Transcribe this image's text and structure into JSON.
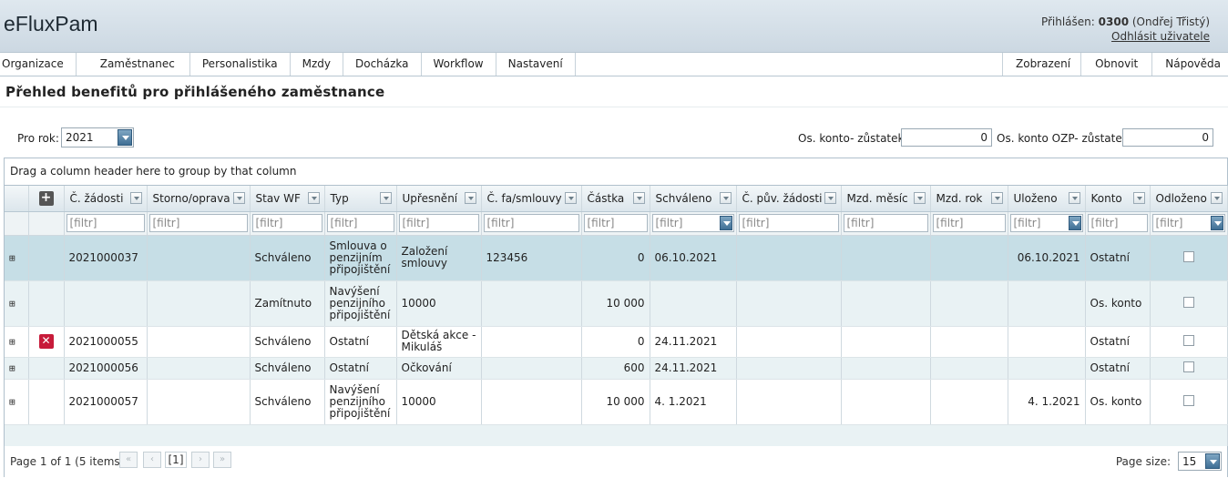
{
  "app": {
    "title": "eFluxPam"
  },
  "user": {
    "logged_label": "Přihlášen:",
    "id": "0300",
    "name": "(Ondřej Třistý)",
    "logout": "Odhlásit uživatele"
  },
  "menu": {
    "left": [
      "Organizace",
      "Zaměstnanec",
      "Personalistika",
      "Mzdy",
      "Docházka",
      "Workflow",
      "Nastavení"
    ],
    "right": [
      "Zobrazení",
      "Obnovit",
      "Nápověda"
    ]
  },
  "page": {
    "title": "Přehled benefitů pro přihlášeného zaměstnance"
  },
  "filters": {
    "year_label": "Pro rok:",
    "year_value": "2021",
    "konto_label": "Os. konto- zůstatek:",
    "konto_value": "0",
    "ozp_label": "Os. konto OZP- zůstatek:",
    "ozp_value": "0"
  },
  "grid": {
    "group_panel": "Drag a column header here to group by that column",
    "filter_placeholder": "[filtr]",
    "columns": [
      "Č. žádosti",
      "Storno/oprava",
      "Stav WF",
      "Typ",
      "Upřesnění",
      "Č. fa/smlouvy",
      "Částka",
      "Schváleno",
      "Č. pův. žádosti",
      "Mzd. měsíc",
      "Mzd. rok",
      "Uloženo",
      "Konto",
      "Odloženo"
    ],
    "rows": [
      {
        "cislo": "2021000037",
        "storno": "",
        "stav": "Schváleno",
        "typ": "Smlouva o penzijním připojištění",
        "upresneni": "Založení smlouvy",
        "fa": "123456",
        "castka": "0",
        "schvaleno": "06.10.2021",
        "puv": "",
        "mesic": "",
        "rok": "",
        "ulozeno": "06.10.2021",
        "konto": "Ostatní",
        "delete": false
      },
      {
        "cislo": "",
        "storno": "",
        "stav": "Zamítnuto",
        "typ": "Navýšení penzijního připojištění",
        "upresneni": "10000",
        "fa": "",
        "castka": "10 000",
        "schvaleno": "",
        "puv": "",
        "mesic": "",
        "rok": "",
        "ulozeno": "",
        "konto": "Os. konto",
        "delete": false
      },
      {
        "cislo": "2021000055",
        "storno": "",
        "stav": "Schváleno",
        "typ": "Ostatní",
        "upresneni": "Dětská akce - Mikuláš",
        "fa": "",
        "castka": "0",
        "schvaleno": "24.11.2021",
        "puv": "",
        "mesic": "",
        "rok": "",
        "ulozeno": "",
        "konto": "Ostatní",
        "delete": true
      },
      {
        "cislo": "2021000056",
        "storno": "",
        "stav": "Schváleno",
        "typ": "Ostatní",
        "upresneni": "Očkování",
        "fa": "",
        "castka": "600",
        "schvaleno": "24.11.2021",
        "puv": "",
        "mesic": "",
        "rok": "",
        "ulozeno": "",
        "konto": "Ostatní",
        "delete": false
      },
      {
        "cislo": "2021000057",
        "storno": "",
        "stav": "Schváleno",
        "typ": "Navýšení penzijního připojištění",
        "upresneni": "10000",
        "fa": "",
        "castka": "10 000",
        "schvaleno": "4.  1.2021",
        "puv": "",
        "mesic": "",
        "rok": "",
        "ulozeno": "4.  1.2021",
        "konto": "Os. konto",
        "delete": false
      }
    ]
  },
  "pager": {
    "info": "Page 1 of 1 (5 items)",
    "current": "[1]",
    "size_label": "Page size:",
    "size_value": "15"
  },
  "colors": {
    "header_bg": "#d4dfe8",
    "selected_row": "#c6dee6",
    "alt_row": "#e9f2f4",
    "delete_icon": "#c71b3a"
  }
}
